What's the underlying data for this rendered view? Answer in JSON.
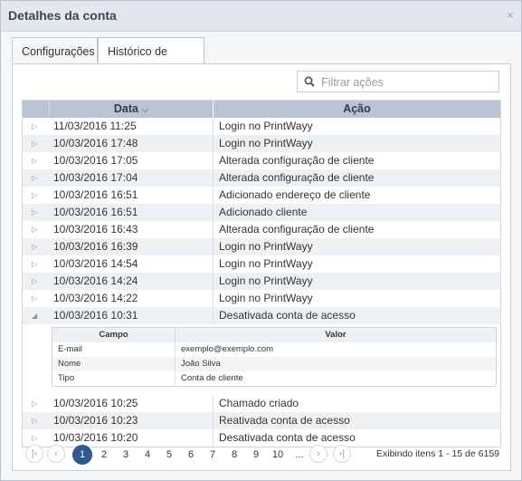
{
  "dialog": {
    "title": "Detalhes da conta",
    "close_symbol": "×"
  },
  "tabs": [
    "Configurações",
    "Histórico de ações"
  ],
  "search": {
    "placeholder": "Filtrar ações",
    "value": ""
  },
  "table": {
    "headers": {
      "date": "Data",
      "action": "Ação",
      "sort_symbol": "⌵"
    },
    "rows": [
      {
        "date": "11/03/2016 11:25",
        "action": "Login no PrintWayy"
      },
      {
        "date": "10/03/2016 17:48",
        "action": "Login no PrintWayy"
      },
      {
        "date": "10/03/2016 17:05",
        "action": "Alterada configuração de cliente"
      },
      {
        "date": "10/03/2016 17:04",
        "action": "Alterada configuração de cliente"
      },
      {
        "date": "10/03/2016 16:51",
        "action": "Adicionado endereço de cliente"
      },
      {
        "date": "10/03/2016 16:51",
        "action": "Adicionado cliente"
      },
      {
        "date": "10/03/2016 16:43",
        "action": "Alterada configuração de cliente"
      },
      {
        "date": "10/03/2016 16:39",
        "action": "Login no PrintWayy"
      },
      {
        "date": "10/03/2016 14:54",
        "action": "Login no PrintWayy"
      },
      {
        "date": "10/03/2016 14:24",
        "action": "Login no PrintWayy"
      },
      {
        "date": "10/03/2016 14:22",
        "action": "Login no PrintWayy"
      },
      {
        "date": "10/03/2016 10:31",
        "action": "Desativada conta de acesso",
        "expanded": true
      },
      {
        "date": "10/03/2016 10:25",
        "action": "Chamado criado"
      },
      {
        "date": "10/03/2016 10:23",
        "action": "Reativada conta de acesso"
      },
      {
        "date": "10/03/2016 10:20",
        "action": "Desativada conta de acesso"
      }
    ],
    "detail": {
      "headers": {
        "field": "Campo",
        "value": "Valor"
      },
      "rows": [
        {
          "field": "E-mail",
          "value": "exemplo@exemplo.com"
        },
        {
          "field": "Nome",
          "value": "João Silva"
        },
        {
          "field": "Tipo",
          "value": "Conta de cliente"
        }
      ]
    }
  },
  "pager": {
    "pages": [
      "1",
      "2",
      "3",
      "4",
      "5",
      "6",
      "7",
      "8",
      "9",
      "10",
      "..."
    ],
    "current": "1",
    "info": "Exibindo itens 1 - 15 de 6159"
  }
}
